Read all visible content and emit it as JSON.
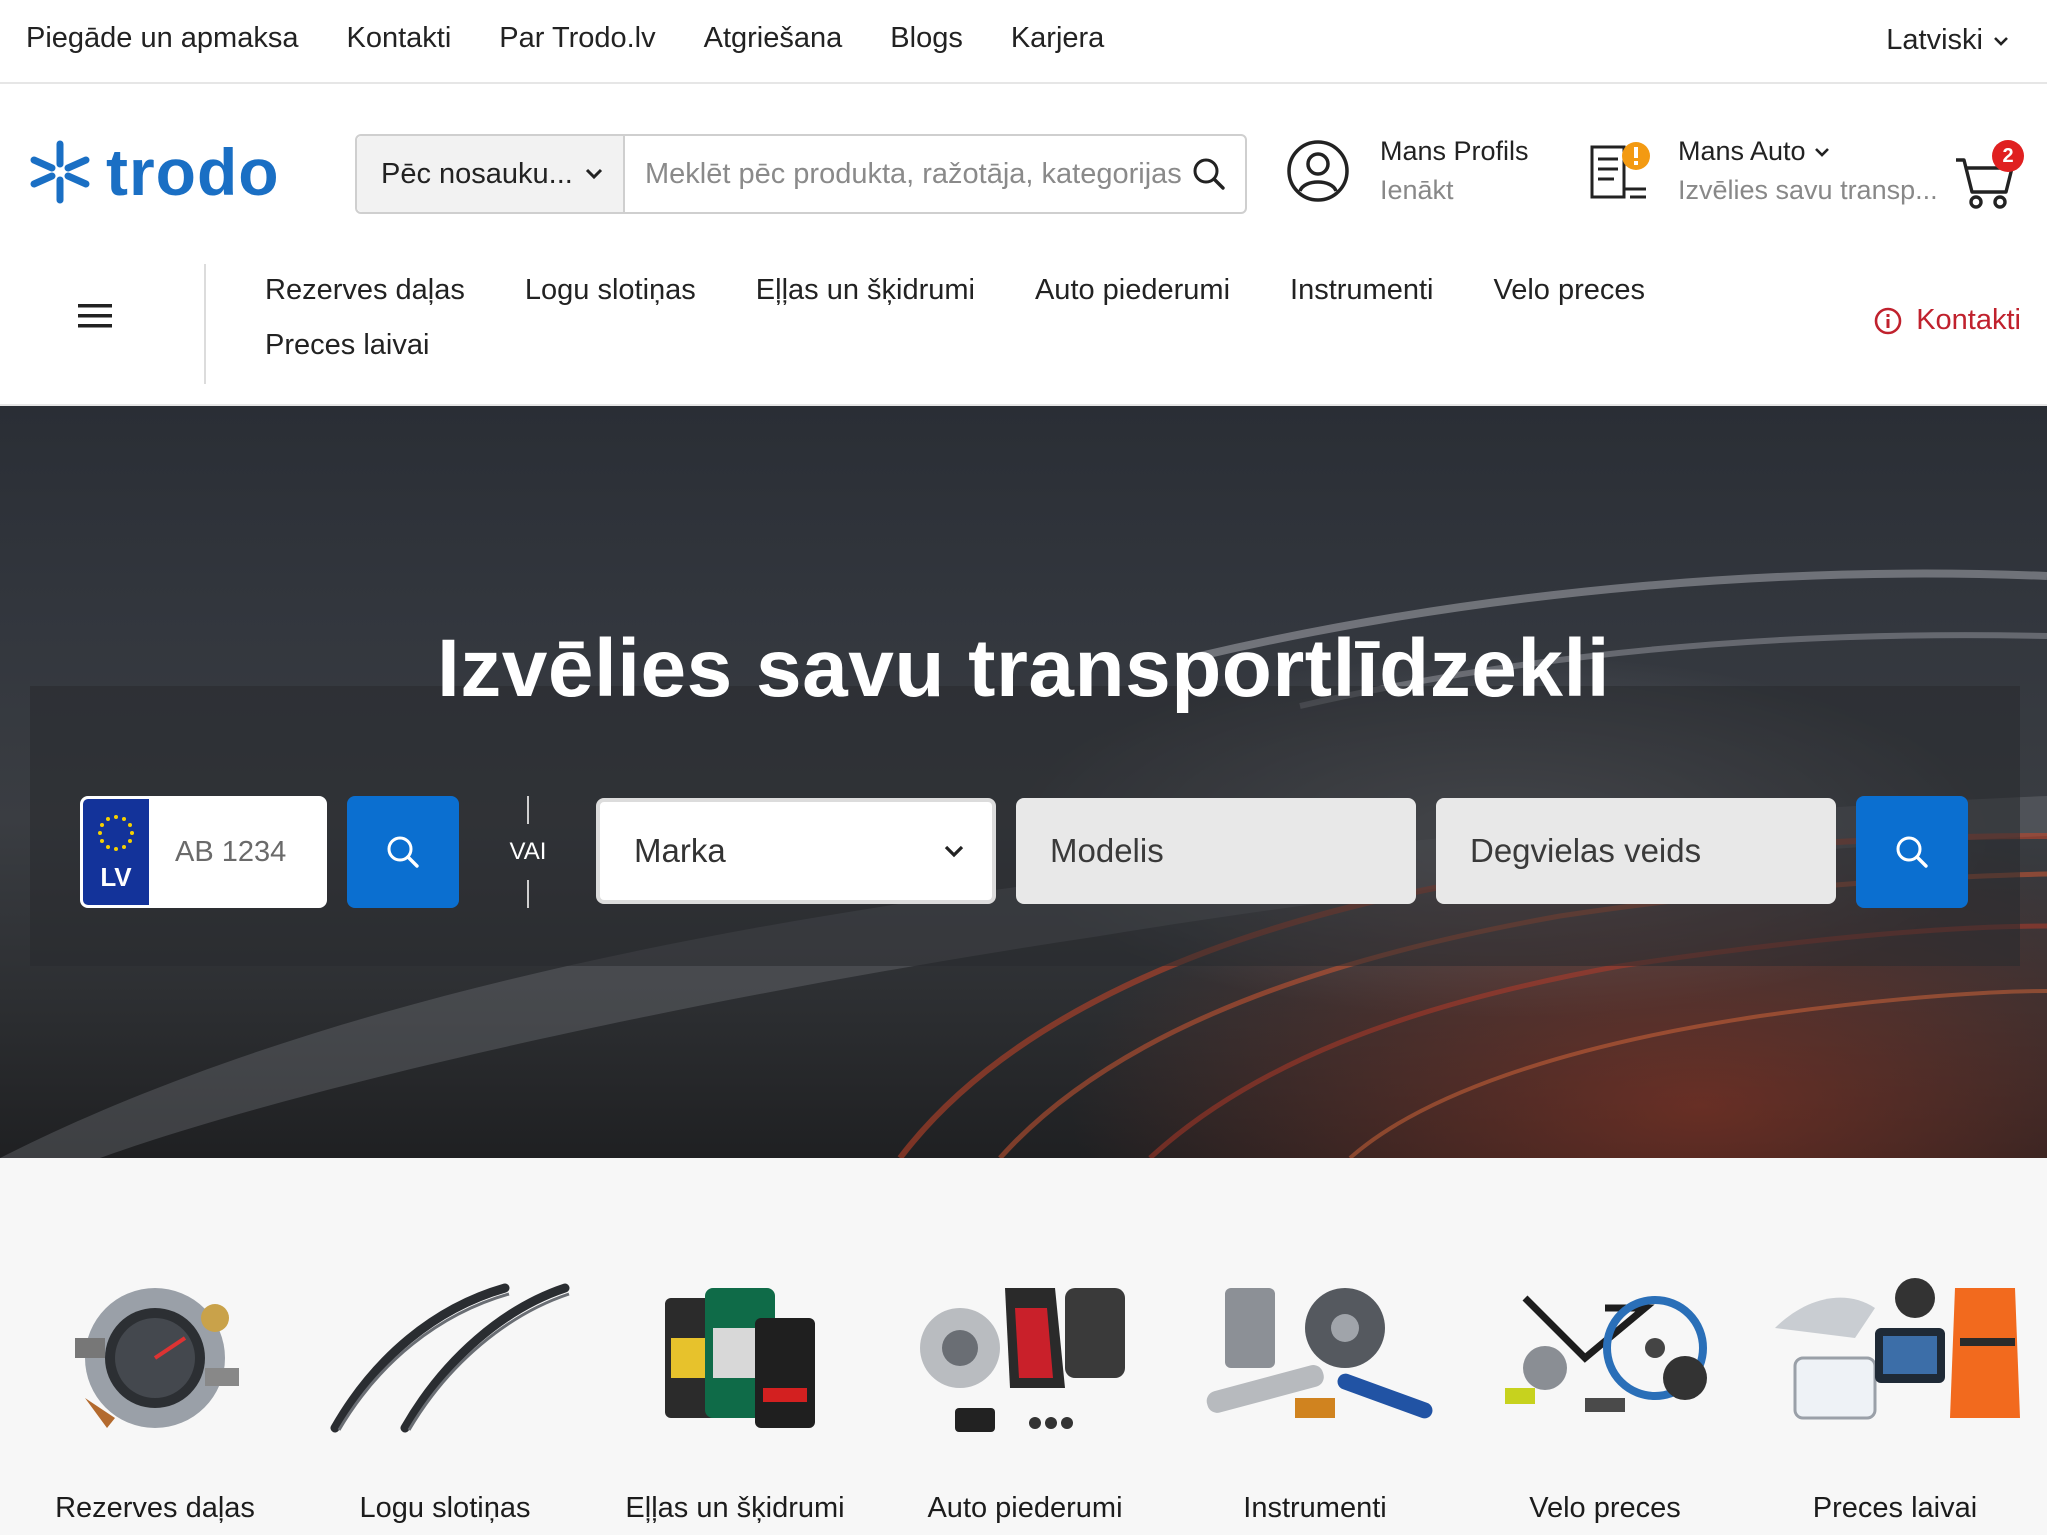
{
  "topbar": {
    "links": [
      "Piegāde un apmaksa",
      "Kontakti",
      "Par Trodo.lv",
      "Atgriešana",
      "Blogs",
      "Karjera"
    ],
    "language": "Latviski"
  },
  "header": {
    "logo_text": "trodo",
    "search_mode": "Pēc nosauku...",
    "search_placeholder": "Meklēt pēc produkta, ražotāja, kategorijas",
    "profile_title": "Mans Profils",
    "profile_subtitle": "Ienākt",
    "myauto_title": "Mans Auto",
    "myauto_subtitle": "Izvēlies savu transp...",
    "cart_count": "2"
  },
  "catnav": {
    "items": [
      "Rezerves daļas",
      "Logu slotiņas",
      "Eļļas un šķidrumi",
      "Auto piederumi",
      "Instrumenti",
      "Velo preces",
      "Preces laivai"
    ],
    "contact_label": "Kontakti"
  },
  "hero": {
    "title": "Izvēlies savu transportlīdzekli",
    "plate_country": "LV",
    "plate_placeholder": "AB 1234",
    "or_label": "VAI",
    "make_label": "Marka",
    "model_label": "Modelis",
    "fuel_label": "Degvielas veids"
  },
  "categories": [
    {
      "label": "Rezerves daļas",
      "icon": "spare-parts-icon"
    },
    {
      "label": "Logu slotiņas",
      "icon": "wipers-icon"
    },
    {
      "label": "Eļļas un šķidrumi",
      "icon": "oil-icon"
    },
    {
      "label": "Auto piederumi",
      "icon": "car-accessories-icon"
    },
    {
      "label": "Instrumenti",
      "icon": "tools-icon"
    },
    {
      "label": "Velo preces",
      "icon": "bicycle-icon"
    },
    {
      "label": "Preces laivai",
      "icon": "boat-icon"
    }
  ],
  "colors": {
    "brand": "#1a6fc4",
    "button": "#0b6fd0",
    "contact": "#c0212d",
    "badge": "#e02020",
    "eu_plate": "#13339a"
  }
}
